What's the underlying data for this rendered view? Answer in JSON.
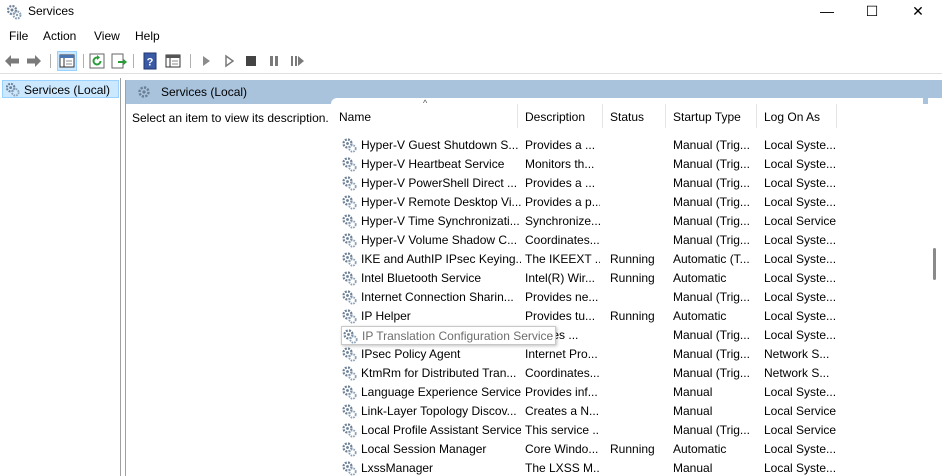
{
  "window": {
    "title": "Services",
    "controls": {
      "minimize": "—",
      "maximize": "☐",
      "close": "✕"
    }
  },
  "menu": [
    "File",
    "Action",
    "View",
    "Help"
  ],
  "toolbar": [
    "back-icon",
    "forward-icon",
    "show-hide-console-tree-icon",
    "refresh-icon",
    "export-list-icon",
    "help-icon",
    "properties-icon",
    "start-service-icon",
    "start-service-alt-icon",
    "stop-service-icon",
    "pause-service-icon",
    "restart-service-icon"
  ],
  "tree": {
    "selected": "Services (Local)"
  },
  "pane": {
    "header": "Services (Local)",
    "description": "Select an item to view its description."
  },
  "columns": {
    "name": "Name",
    "description": "Description",
    "status": "Status",
    "startup": "Startup Type",
    "logon": "Log On As"
  },
  "tooltip": "IP Translation Configuration Service",
  "services": [
    {
      "name": "Hyper-V Guest Shutdown S...",
      "desc": "Provides a ...",
      "status": "",
      "startup": "Manual (Trig...",
      "logon": "Local Syste..."
    },
    {
      "name": "Hyper-V Heartbeat Service",
      "desc": "Monitors th...",
      "status": "",
      "startup": "Manual (Trig...",
      "logon": "Local Syste..."
    },
    {
      "name": "Hyper-V PowerShell Direct ...",
      "desc": "Provides a ...",
      "status": "",
      "startup": "Manual (Trig...",
      "logon": "Local Syste..."
    },
    {
      "name": "Hyper-V Remote Desktop Vi...",
      "desc": "Provides a p...",
      "status": "",
      "startup": "Manual (Trig...",
      "logon": "Local Syste..."
    },
    {
      "name": "Hyper-V Time Synchronizati...",
      "desc": "Synchronize...",
      "status": "",
      "startup": "Manual (Trig...",
      "logon": "Local Service"
    },
    {
      "name": "Hyper-V Volume Shadow C...",
      "desc": "Coordinates...",
      "status": "",
      "startup": "Manual (Trig...",
      "logon": "Local Syste..."
    },
    {
      "name": "IKE and AuthIP IPsec Keying...",
      "desc": "The IKEEXT ...",
      "status": "Running",
      "startup": "Automatic (T...",
      "logon": "Local Syste..."
    },
    {
      "name": "Intel Bluetooth Service",
      "desc": "Intel(R) Wir...",
      "status": "Running",
      "startup": "Automatic",
      "logon": "Local Syste..."
    },
    {
      "name": "Internet Connection Sharin...",
      "desc": "Provides ne...",
      "status": "",
      "startup": "Manual (Trig...",
      "logon": "Local Syste..."
    },
    {
      "name": "IP Helper",
      "desc": "Provides tu...",
      "status": "Running",
      "startup": "Automatic",
      "logon": "Local Syste..."
    },
    {
      "name": "IP Translation Configuration Service",
      "desc": "...gures ...",
      "status": "",
      "startup": "Manual (Trig...",
      "logon": "Local Syste..."
    },
    {
      "name": "IPsec Policy Agent",
      "desc": "Internet Pro...",
      "status": "",
      "startup": "Manual (Trig...",
      "logon": "Network S..."
    },
    {
      "name": "KtmRm for Distributed Tran...",
      "desc": "Coordinates...",
      "status": "",
      "startup": "Manual (Trig...",
      "logon": "Network S..."
    },
    {
      "name": "Language Experience Service",
      "desc": "Provides inf...",
      "status": "",
      "startup": "Manual",
      "logon": "Local Syste..."
    },
    {
      "name": "Link-Layer Topology Discov...",
      "desc": "Creates a N...",
      "status": "",
      "startup": "Manual",
      "logon": "Local Service"
    },
    {
      "name": "Local Profile Assistant Service",
      "desc": "This service ...",
      "status": "",
      "startup": "Manual (Trig...",
      "logon": "Local Service"
    },
    {
      "name": "Local Session Manager",
      "desc": "Core Windo...",
      "status": "Running",
      "startup": "Automatic",
      "logon": "Local Syste..."
    },
    {
      "name": "LxssManager",
      "desc": "The LXSS M...",
      "status": "",
      "startup": "Manual",
      "logon": "Local Syste..."
    }
  ]
}
